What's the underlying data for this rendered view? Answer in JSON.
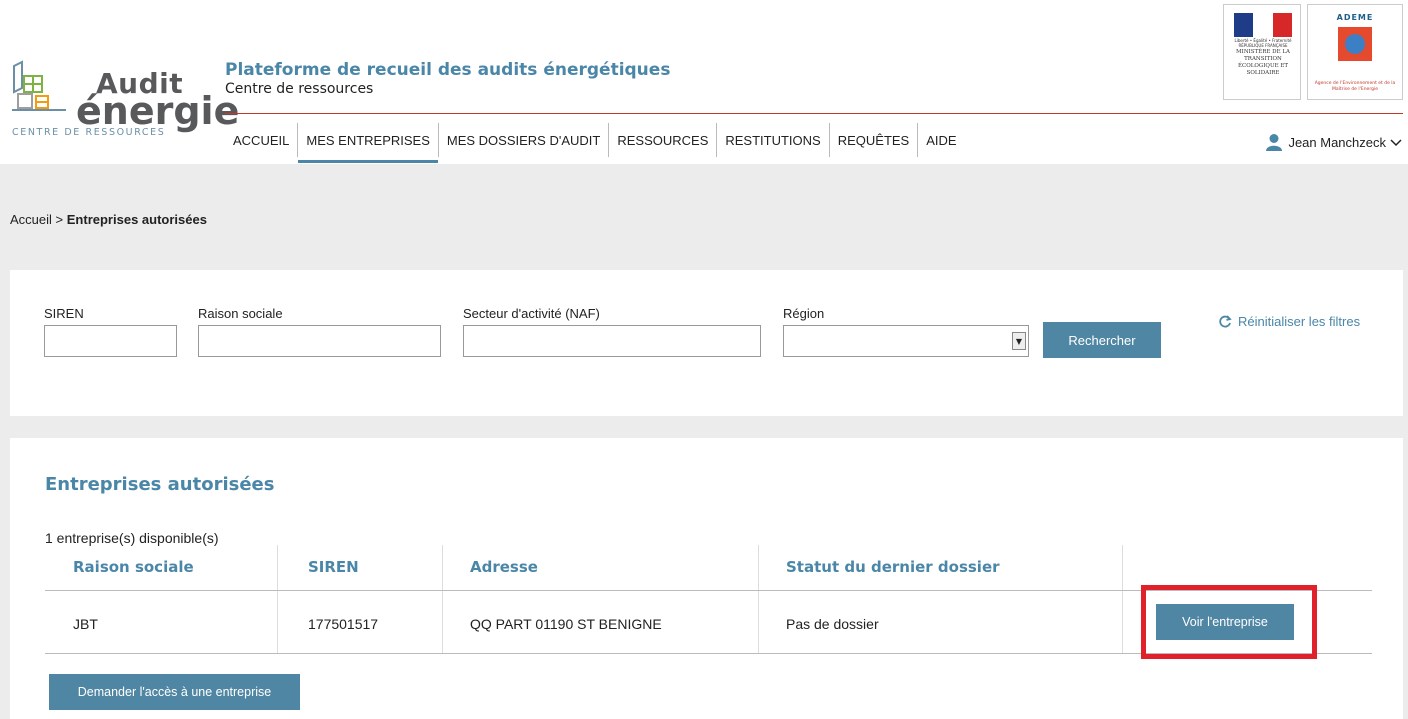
{
  "header": {
    "logo_audit": "Audit",
    "logo_energie": "énergie",
    "logo_subtitle": "CENTRE DE RESSOURCES",
    "platform_title": "Plateforme de recueil des audits énergétiques",
    "platform_subtitle": "Centre de ressources",
    "gov_logo_text": "MINISTÈRE DE LA TRANSITION ÉCOLOGIQUE ET SOLIDAIRE",
    "gov_logo_motto": "Liberté • Égalité • Fraternité RÉPUBLIQUE FRANÇAISE",
    "ademe_title": "ADEME",
    "ademe_text": "Agence de l'Environnement et de la Maîtrise de l'Energie",
    "colors": {
      "accent": "#4a86a8",
      "rule": "#c0392b"
    }
  },
  "nav": {
    "items": [
      {
        "label": "ACCUEIL"
      },
      {
        "label": "MES ENTREPRISES",
        "active": true
      },
      {
        "label": "MES DOSSIERS D'AUDIT"
      },
      {
        "label": "RESSOURCES"
      },
      {
        "label": "RESTITUTIONS"
      },
      {
        "label": "REQUÊTES"
      },
      {
        "label": "AIDE"
      }
    ]
  },
  "user": {
    "name": "Jean Manchzeck",
    "icon": "user-icon",
    "chevron": "chevron-down-icon"
  },
  "breadcrumb": {
    "home": "Accueil",
    "separator": ">",
    "current": "Entreprises autorisées"
  },
  "filters": {
    "siren_label": "SIREN",
    "siren_value": "",
    "raison_label": "Raison sociale",
    "raison_value": "",
    "secteur_label": "Secteur d'activité (NAF)",
    "secteur_value": "",
    "region_label": "Région",
    "region_value": "",
    "search_button": "Rechercher",
    "reset_label": "Réinitialiser les filtres"
  },
  "results": {
    "title": "Entreprises autorisées",
    "count": "1 entreprise(s) disponible(s)",
    "columns": [
      "Raison sociale",
      "SIREN",
      "Adresse",
      "Statut du dernier dossier"
    ],
    "rows": [
      {
        "raison": "JBT",
        "siren": "177501517",
        "adresse": "QQ PART 01190 ST BENIGNE",
        "statut": "Pas de dossier",
        "action": "Voir l'entreprise"
      }
    ],
    "request_button": "Demander l'accès à une entreprise",
    "highlight_color": "#e0202a"
  }
}
